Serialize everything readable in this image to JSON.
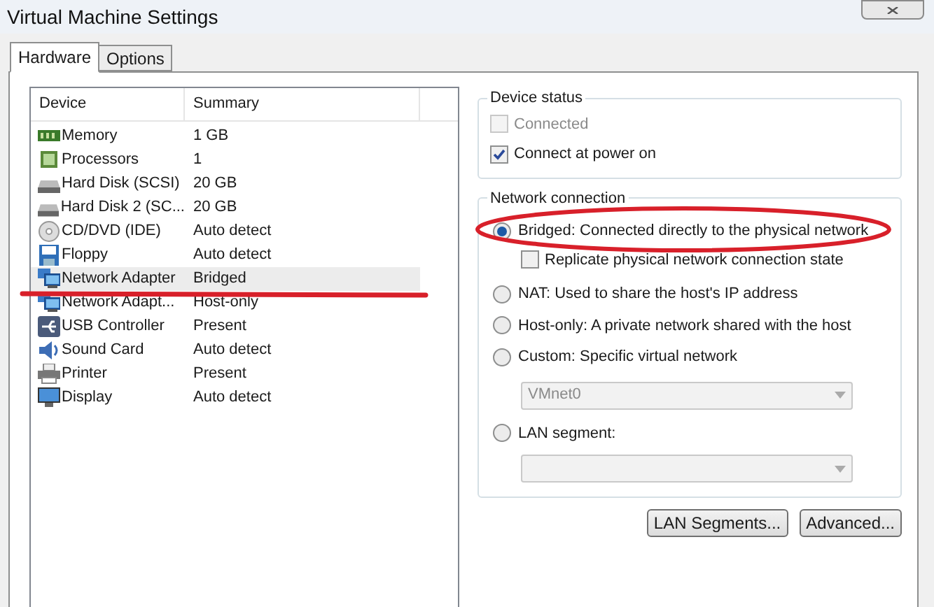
{
  "window": {
    "title": "Virtual Machine Settings"
  },
  "tabs": [
    {
      "label": "Hardware",
      "selected": true
    },
    {
      "label": "Options",
      "selected": false
    }
  ],
  "device_list": {
    "columns": [
      "Device",
      "Summary"
    ],
    "rows": [
      {
        "kind": "memory",
        "device": "Memory",
        "summary": "1 GB",
        "selected": false
      },
      {
        "kind": "processor",
        "device": "Processors",
        "summary": "1",
        "selected": false
      },
      {
        "kind": "disk",
        "device": "Hard Disk (SCSI)",
        "summary": "20 GB",
        "selected": false
      },
      {
        "kind": "disk",
        "device": "Hard Disk 2 (SC...",
        "summary": "20 GB",
        "selected": false
      },
      {
        "kind": "cd",
        "device": "CD/DVD (IDE)",
        "summary": "Auto detect",
        "selected": false
      },
      {
        "kind": "floppy",
        "device": "Floppy",
        "summary": "Auto detect",
        "selected": false
      },
      {
        "kind": "network",
        "device": "Network Adapter",
        "summary": "Bridged",
        "selected": true
      },
      {
        "kind": "network",
        "device": "Network Adapt...",
        "summary": "Host-only",
        "selected": false
      },
      {
        "kind": "usb",
        "device": "USB Controller",
        "summary": "Present",
        "selected": false
      },
      {
        "kind": "sound",
        "device": "Sound Card",
        "summary": "Auto detect",
        "selected": false
      },
      {
        "kind": "printer",
        "device": "Printer",
        "summary": "Present",
        "selected": false
      },
      {
        "kind": "display",
        "device": "Display",
        "summary": "Auto detect",
        "selected": false
      }
    ]
  },
  "device_status": {
    "title": "Device status",
    "options": [
      {
        "label": "Connected",
        "checked": false,
        "disabled": true
      },
      {
        "label": "Connect at power on",
        "checked": true,
        "disabled": false
      }
    ]
  },
  "network_connection": {
    "title": "Network connection",
    "bridged": {
      "label": "Bridged: Connected directly to the physical network",
      "selected": true
    },
    "replicate": {
      "label": "Replicate physical network connection state",
      "checked": false
    },
    "nat": {
      "label": "NAT: Used to share the host's IP address",
      "selected": false
    },
    "host_only": {
      "label": "Host-only: A private network shared with the host",
      "selected": false
    },
    "custom": {
      "label": "Custom: Specific virtual network",
      "selected": false
    },
    "custom_network": {
      "value": "VMnet0",
      "disabled": true
    },
    "lan_segment": {
      "label": "LAN segment:",
      "selected": false
    },
    "lan_segment_select": {
      "disabled": true
    }
  },
  "buttons": [
    "LAN Segments...",
    "Advanced..."
  ]
}
